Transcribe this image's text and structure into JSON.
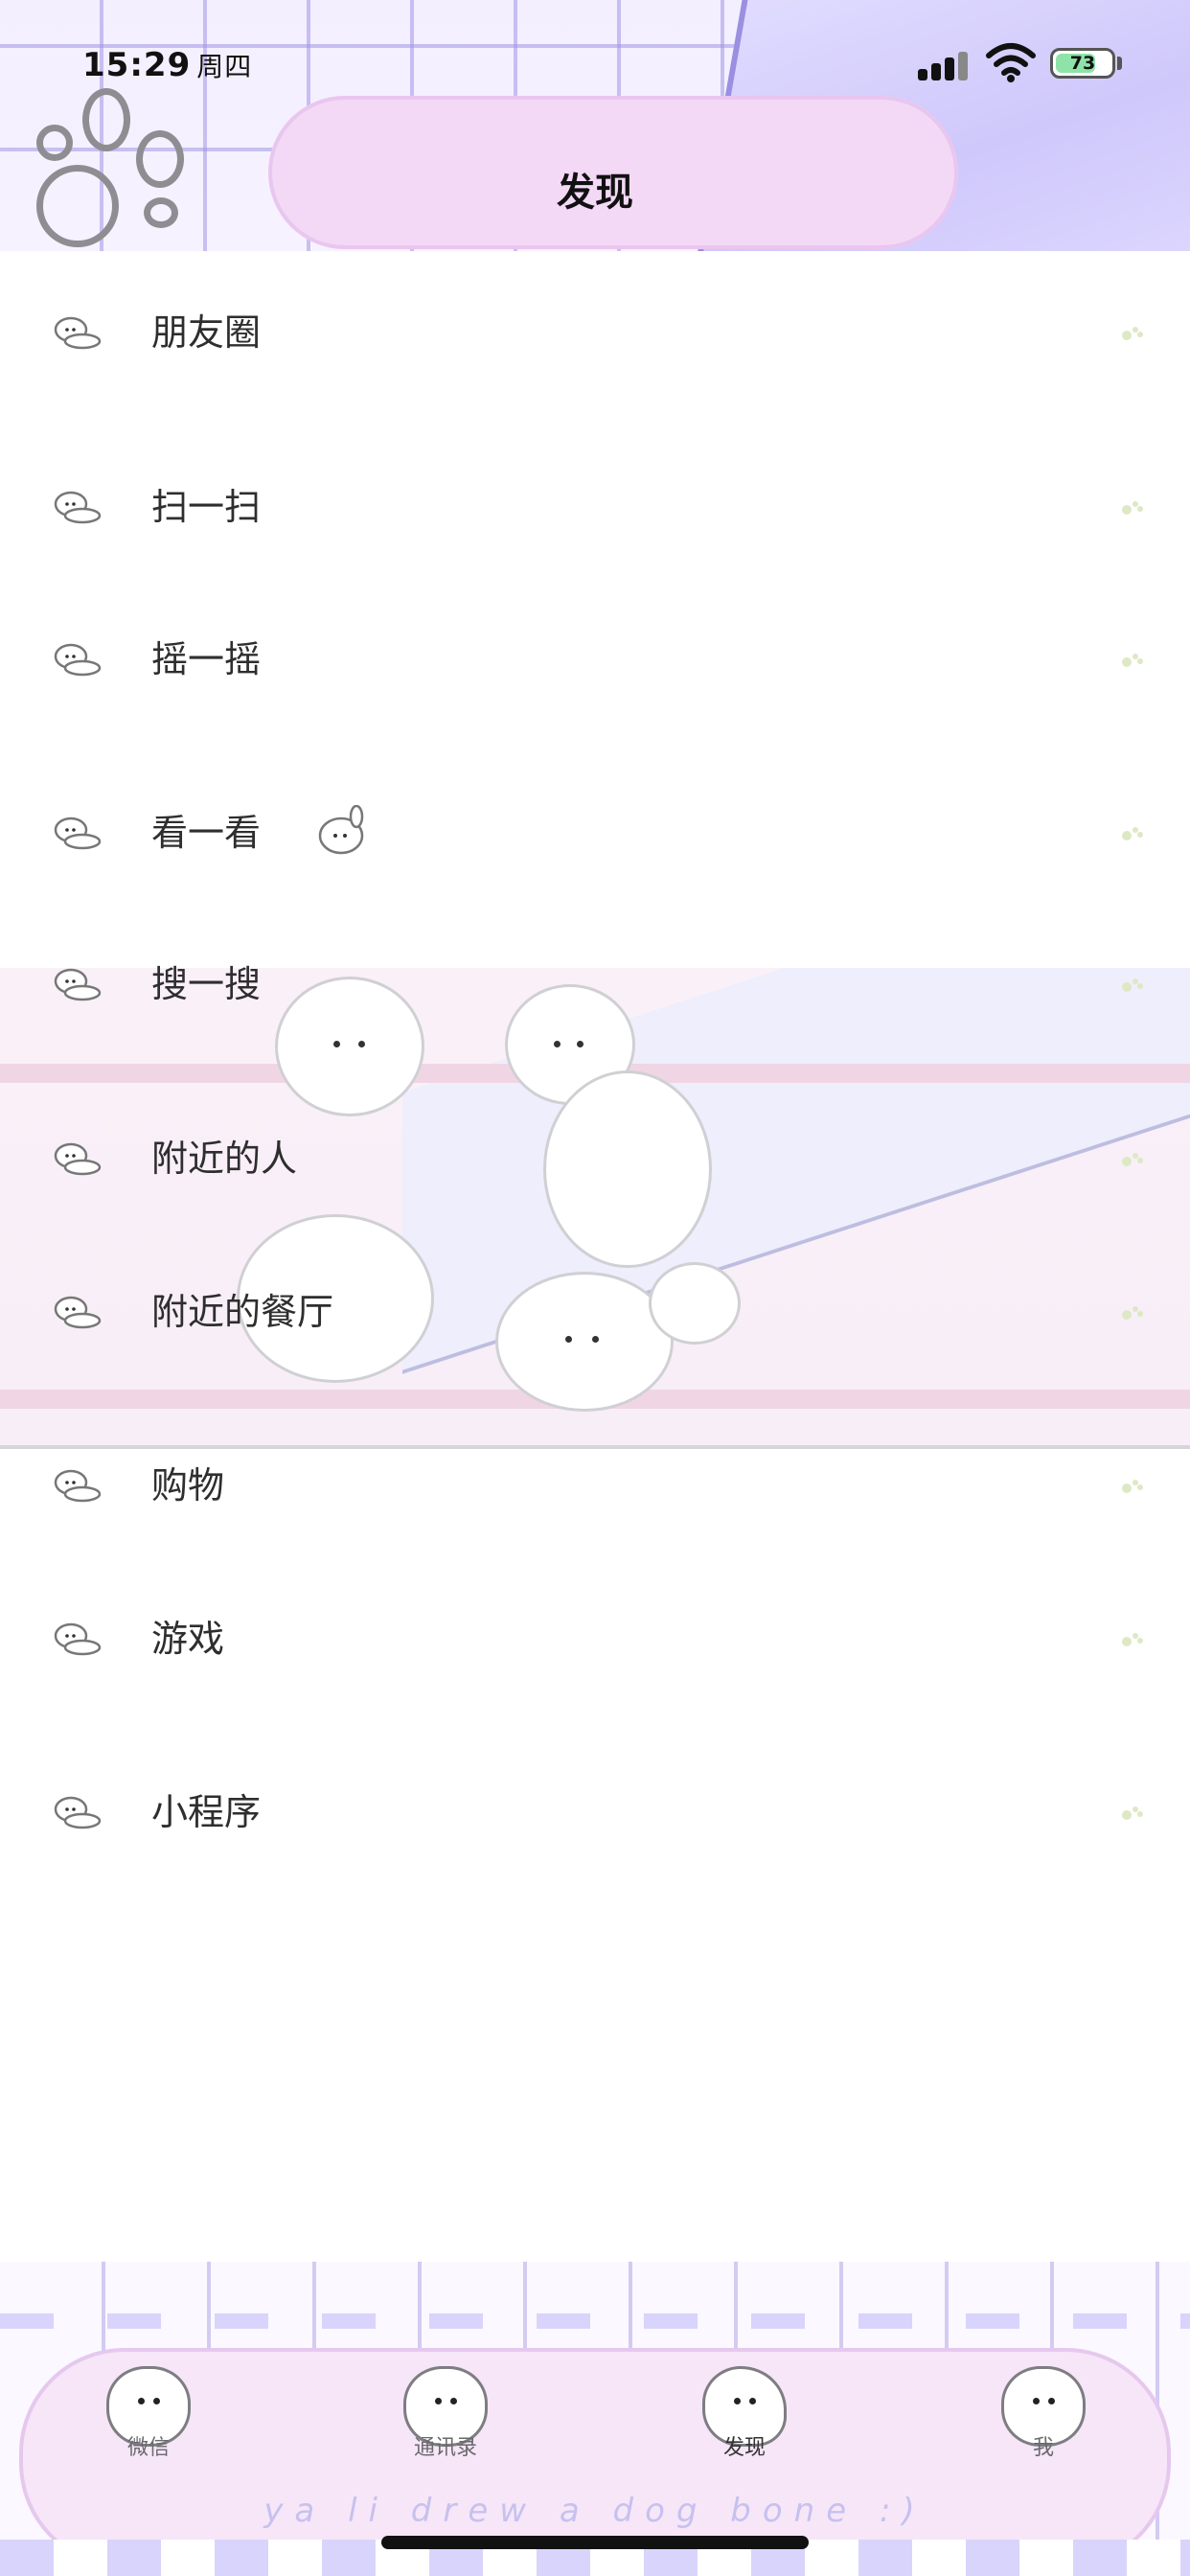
{
  "status_bar": {
    "time": "15:29",
    "weekday": "周四",
    "battery": "73",
    "battery_level": 0.73
  },
  "header": {
    "title": "发现"
  },
  "menu": {
    "items": [
      {
        "label": "朋友圈"
      },
      {
        "label": "扫一扫"
      },
      {
        "label": "摇一摇"
      },
      {
        "label": "看一看"
      },
      {
        "label": "搜一搜"
      },
      {
        "label": "附近的人"
      },
      {
        "label": "附近的餐厅"
      },
      {
        "label": "购物"
      },
      {
        "label": "游戏"
      },
      {
        "label": "小程序"
      }
    ]
  },
  "tabbar": {
    "tabs": [
      {
        "label": "微信"
      },
      {
        "label": "通讯录"
      },
      {
        "label": "发现"
      },
      {
        "label": "我"
      }
    ],
    "bone_text": "ya li drew a dog bone :)"
  },
  "colors": {
    "header_bg": "#f3efff",
    "cloud_pink": "#f3d9f6",
    "chevron": "#d7e7b8"
  }
}
